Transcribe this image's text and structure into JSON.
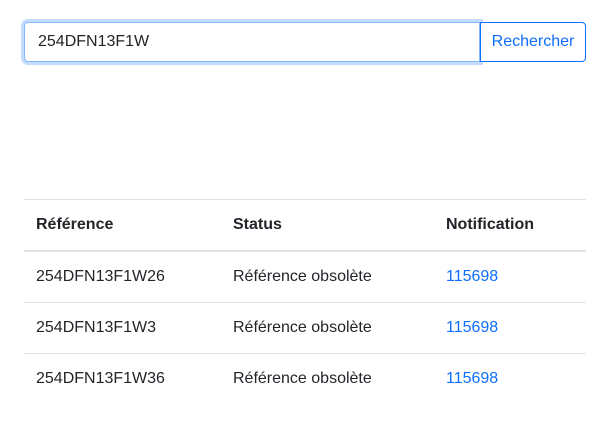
{
  "search": {
    "value": "254DFN13F1W",
    "button_label": "Rechercher"
  },
  "table": {
    "headers": {
      "reference": "Référence",
      "status": "Status",
      "notification": "Notification"
    },
    "rows": [
      {
        "reference": "254DFN13F1W26",
        "status": "Référence obsolète",
        "notification": "115698"
      },
      {
        "reference": "254DFN13F1W3",
        "status": "Référence obsolète",
        "notification": "115698"
      },
      {
        "reference": "254DFN13F1W36",
        "status": "Référence obsolète",
        "notification": "115698"
      }
    ]
  },
  "colors": {
    "accent": "#0d6efd",
    "focus_border": "#86b7fe",
    "row_divider": "#dee2e6",
    "text": "#212529"
  }
}
